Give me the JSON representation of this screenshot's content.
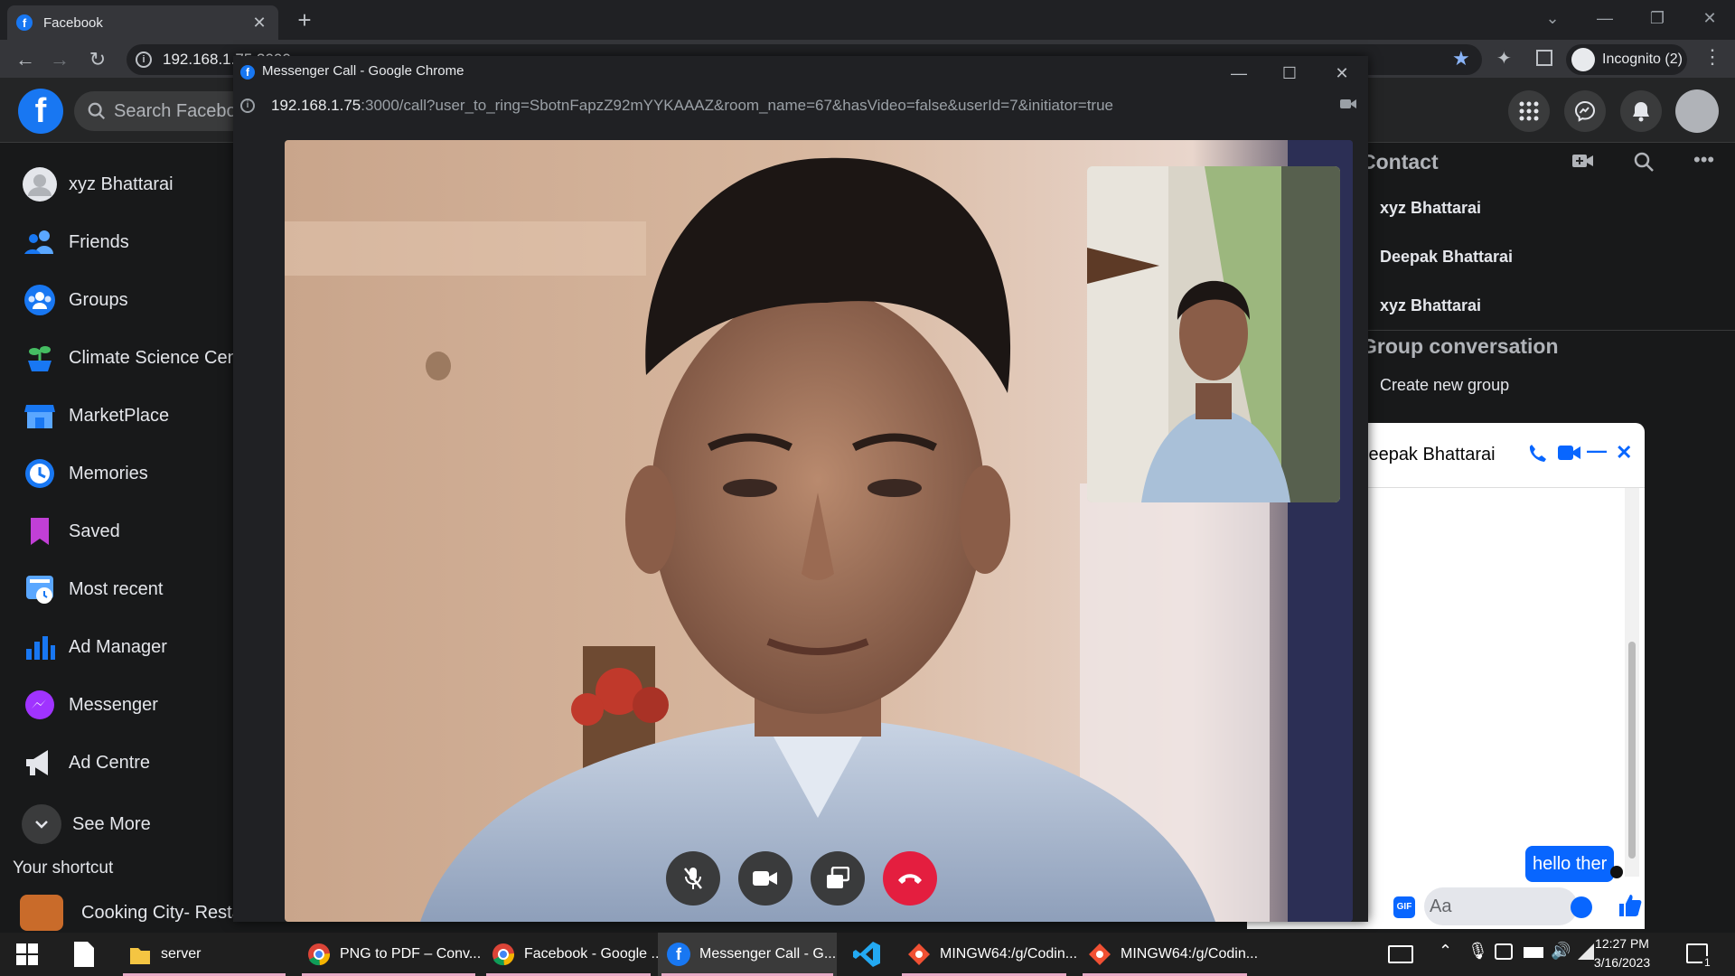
{
  "browser": {
    "tab_title": "Facebook",
    "url_partial": "192.168.1.75:3000",
    "profile_label": "Incognito (2)"
  },
  "facebook": {
    "search_placeholder": "Search Facebook",
    "sidebar": [
      {
        "label": "xyz Bhattarai",
        "icon": "profile-avatar-icon"
      },
      {
        "label": "Friends",
        "icon": "friends-icon"
      },
      {
        "label": "Groups",
        "icon": "groups-icon"
      },
      {
        "label": "Climate Science Centre",
        "icon": "climate-icon"
      },
      {
        "label": "MarketPlace",
        "icon": "marketplace-icon"
      },
      {
        "label": "Memories",
        "icon": "memories-icon"
      },
      {
        "label": "Saved",
        "icon": "saved-icon"
      },
      {
        "label": "Most recent",
        "icon": "most-recent-icon"
      },
      {
        "label": "Ad Manager",
        "icon": "ad-manager-icon"
      },
      {
        "label": "Messenger",
        "icon": "messenger-icon"
      },
      {
        "label": "Ad Centre",
        "icon": "ad-centre-icon"
      },
      {
        "label": "See More",
        "icon": "chevron-down-icon"
      }
    ],
    "shortcut_title": "Your shortcut",
    "shortcut_item": "Cooking City- Restaurant Game",
    "contacts_title": "Contact",
    "contacts": [
      "xyz Bhattarai",
      "Deepak Bhattarai",
      "xyz Bhattarai"
    ],
    "group_title": "Group conversation",
    "create_group": "Create new group"
  },
  "chat": {
    "name": "Deepak Bhattarai",
    "message": "hello ther",
    "input_placeholder": "Aa",
    "gif_label": "GIF"
  },
  "popup": {
    "title": "Messenger Call - Google Chrome",
    "url_host": "192.168.1.75",
    "url_rest": ":3000/call?user_to_ring=SbotnFapzZ92mYYKAAAZ&room_name=67&hasVideo=false&userId=7&initiator=true"
  },
  "taskbar": {
    "items": [
      "server",
      "PNG to PDF – Conv...",
      "Facebook - Google ...",
      "Messenger Call - G...",
      "MINGW64:/g/Codin...",
      "MINGW64:/g/Codin..."
    ],
    "time": "12:27 PM",
    "date": "3/16/2023",
    "notification_count": "1"
  },
  "colors": {
    "fb_blue": "#1877f2",
    "end_call_red": "#e41e3f",
    "messenger_blue": "#0866ff"
  }
}
